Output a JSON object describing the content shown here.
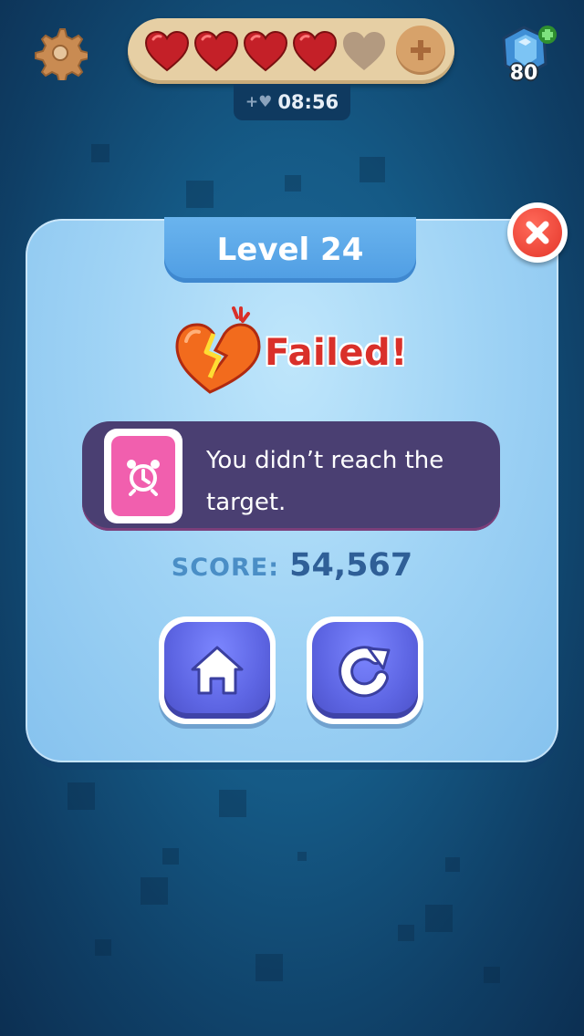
{
  "top_bar": {
    "lives_total": 5,
    "lives_filled": 4,
    "timer": "08:56",
    "gem_count": "80"
  },
  "dialog": {
    "title": "Level 24",
    "status": "Failed!",
    "message": "You didn’t reach the target.",
    "score_label": "SCORE:",
    "score_value": "54,567"
  },
  "colors": {
    "heart_filled": "#c42028",
    "heart_empty": "#b39a80",
    "failed_text": "#d9302a",
    "button_purple": "#5d65e3",
    "close_red": "#e4362a"
  }
}
